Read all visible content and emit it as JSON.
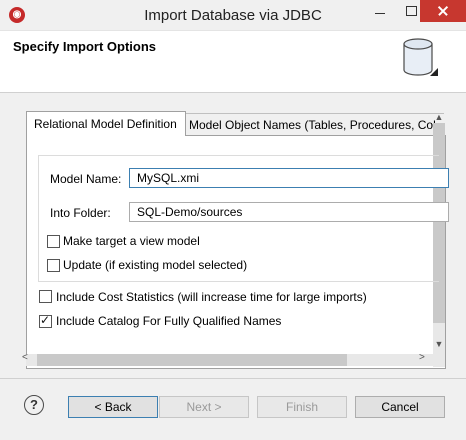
{
  "window": {
    "title": "Import Database via JDBC",
    "app_icon_glyph": "◉"
  },
  "header": {
    "title": "Specify Import Options",
    "icon": "database-icon"
  },
  "tabs": [
    {
      "label": "Relational Model Definition",
      "active": true
    },
    {
      "label": "Model Object Names (Tables, Procedures, Col",
      "active": false
    }
  ],
  "form": {
    "model_name_label": "Model Name:",
    "model_name_value": "MySQL.xmi",
    "into_folder_label": "Into Folder:",
    "into_folder_value": "SQL-Demo/sources",
    "make_view_label": "Make target a view model",
    "make_view_checked": false,
    "update_label": "Update (if existing model selected)",
    "update_checked": false,
    "cost_label": "Include Cost Statistics (will increase time for large imports)",
    "cost_checked": false,
    "catalog_label": "Include Catalog For Fully Qualified Names",
    "catalog_checked": true
  },
  "scroll": {
    "up": "▲",
    "down": "▼",
    "left": "<",
    "right": ">"
  },
  "buttons": {
    "help": "?",
    "back": "< Back",
    "next": "Next >",
    "finish": "Finish",
    "cancel": "Cancel"
  },
  "colors": {
    "accent": "#3c7fb1",
    "close": "#c7372f"
  }
}
